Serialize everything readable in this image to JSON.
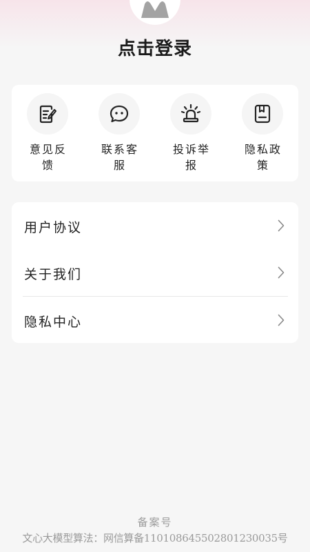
{
  "header": {
    "login_text": "点击登录",
    "avatar_icon": "user-avatar-icon",
    "gradient_color": "#f7e4ea"
  },
  "quick_actions": [
    {
      "label": "意见反馈",
      "icon": "feedback-edit-icon"
    },
    {
      "label": "联系客服",
      "icon": "chat-bubble-icon"
    },
    {
      "label": "投诉举报",
      "icon": "alarm-siren-icon"
    },
    {
      "label": "隐私政策",
      "icon": "bookmark-document-icon"
    }
  ],
  "menu": [
    {
      "label": "用户协议",
      "icon": "chevron-right-icon"
    },
    {
      "label": "关于我们",
      "icon": "chevron-right-icon"
    },
    {
      "label": "隐私中心",
      "icon": "chevron-right-icon"
    }
  ],
  "footer": {
    "beian_title": "备案号",
    "beian_text": "文心大模型算法：网信算备110108645502801230035号"
  }
}
